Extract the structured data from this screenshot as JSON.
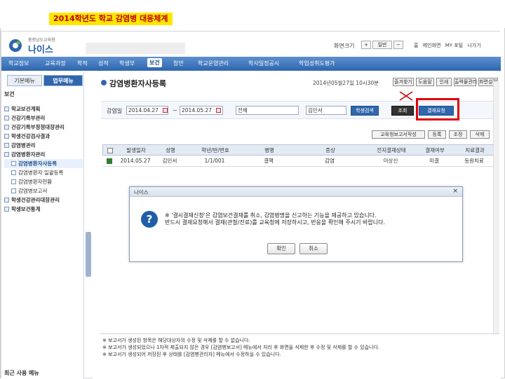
{
  "slide_title": "2014학년도 학교 감염병 대응체계",
  "header": {
    "logo_sub": "충청남도교육청",
    "logo_name": "나이스",
    "screen_size_label": "화면크기",
    "zoom_in": "+",
    "zoom_normal": "일반",
    "zoom_out": "−",
    "top_links": [
      "홈",
      "메인화면",
      "MY 포털",
      "나가기"
    ]
  },
  "menubar": {
    "items": [
      "학교정보",
      "교육과정",
      "학적",
      "성적",
      "학생부",
      "보건",
      "창안",
      "학교운영관리",
      "학사일정공시",
      "학업성취도평가"
    ],
    "active_index": 5
  },
  "left": {
    "tabs": {
      "basic": "기본메뉴",
      "work": "업무메뉴"
    },
    "section": "보건",
    "tree": [
      {
        "label": "학교보건계획",
        "kind": "group"
      },
      {
        "label": "건강기록부관리",
        "kind": "group"
      },
      {
        "label": "건강기록부정정대장관리",
        "kind": "group"
      },
      {
        "label": "학생건강검사결과",
        "kind": "group"
      },
      {
        "label": "감염병관리",
        "kind": "group"
      },
      {
        "label": "감염병환자관리",
        "kind": "group"
      },
      {
        "label": "감염병환자사등록",
        "kind": "sub",
        "current": true
      },
      {
        "label": "감염병환자 일괄등록",
        "kind": "sub"
      },
      {
        "label": "감염병환자현황",
        "kind": "sub"
      },
      {
        "label": "감염병보고서",
        "kind": "sub"
      },
      {
        "label": "학생건강관리대장관리",
        "kind": "group"
      },
      {
        "label": "학생보건통계",
        "kind": "group"
      }
    ],
    "recent_label": "최근 사용 메뉴"
  },
  "main": {
    "title": "감염병환자사등록",
    "stamp": "2014년05월27일 10시30분",
    "top_buttons": [
      "즐겨찾기",
      "도움말",
      "인쇄",
      "출력물관리",
      "화면설정"
    ],
    "search": {
      "period_label": "감염일",
      "date_from": "2014.04.27",
      "tilde": "~",
      "date_to": "2014.05.27",
      "scope_value": "전체",
      "name_value": "김민서",
      "student_search_btn": "학생검색",
      "search_btn": "조회",
      "request_btn": "결재요청"
    },
    "action_buttons": [
      "교육청보고서작성",
      "등록",
      "조정",
      "삭제"
    ],
    "grid": {
      "headers": [
        "",
        "발생일자",
        "성명",
        "학년/반/번호",
        "병명",
        "증상",
        "전지결재상태",
        "결재여부",
        "치료결과"
      ],
      "rows": [
        [
          "",
          "2014.05.27",
          "김민서",
          "1/1/001",
          "결핵",
          "감염",
          "미상신",
          "미결",
          "등원치료"
        ]
      ]
    }
  },
  "dialog": {
    "title": "나이스",
    "close": "×",
    "icon": "?",
    "line1": "※ '결시결재신청'은 감염보건결재를 취소, 감염병명을 신고하는 기능을 제공하고 있습니다.",
    "line2": "반드시 결재요청해서 결재(관찰/진료)를 교육청에 저장하시고, 반응을 확인해 주시기 바랍니다.",
    "ok": "확인",
    "cancel": "취소"
  },
  "notices": [
    "※ 보고서가 생성된 항목은 해당대상자의 수정 및 삭제를 할 수 없습니다.",
    "※ 보고서가 생성되었으나 1차적 제출되지 않은 경우 [감염병보고서] 메뉴에서 처리 후 화면을 삭제한 후 수정 및 삭제를 할 수 있습니다.",
    "※ 보고서가 생성되어 저장된 후 상태를 [감염병관리자] 메뉴에서 수정하실 수 있습니다."
  ]
}
